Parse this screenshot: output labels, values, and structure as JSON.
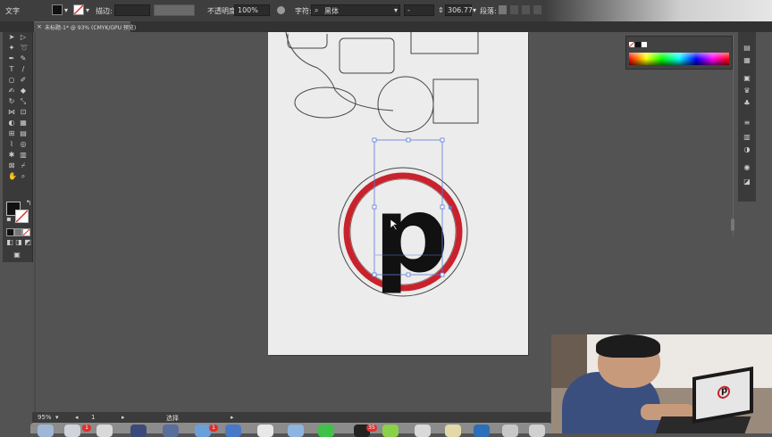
{
  "control_bar": {
    "mode_label": "文字",
    "stroke_label": "描边:",
    "opacity_label": "不透明度:",
    "opacity_value": "100%",
    "character_label": "字符:",
    "font_value": "黑体",
    "font_style_value": "-",
    "font_size_value": "306.77",
    "paragraph_label": "段落:"
  },
  "document_tab": {
    "title": "未标题-1* @ 93% (CMYK/GPU 预览)"
  },
  "status_bar": {
    "zoom": "95%",
    "artboard_number": "1",
    "tool_readout": "选择"
  },
  "artwork": {
    "glyph": "p",
    "fill_color": "#111111",
    "ring_color": "#c8232c"
  },
  "dock": {
    "badges": [
      "1",
      "1",
      "35"
    ]
  },
  "webcam_laptop_glyph": "p"
}
